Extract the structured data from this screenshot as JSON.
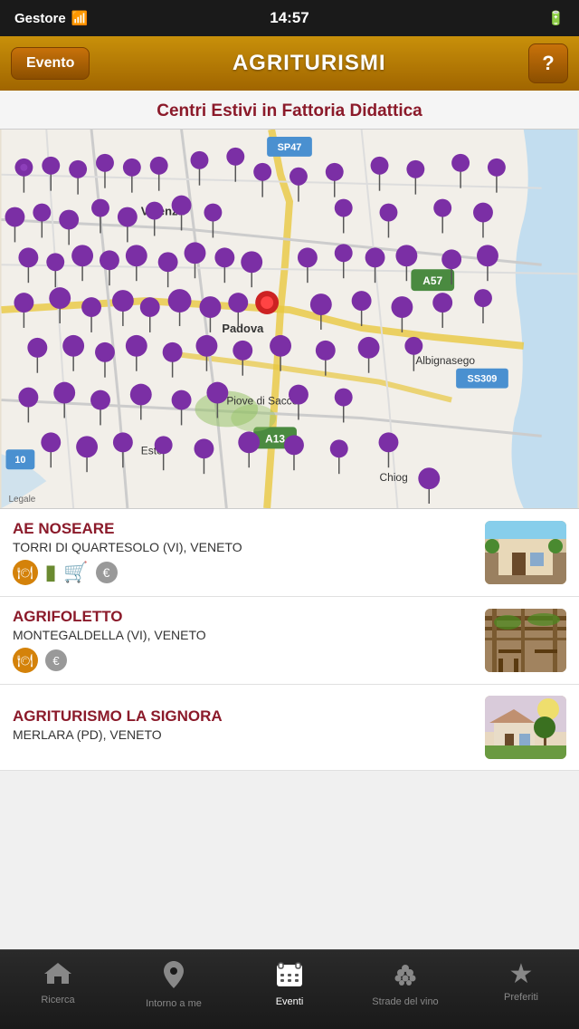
{
  "statusBar": {
    "carrier": "Gestore",
    "time": "14:57",
    "batteryIcon": "▐▌"
  },
  "navBar": {
    "eventoLabel": "Evento",
    "title": "AGRITURISMI",
    "helpLabel": "?"
  },
  "subtitle": "Centri Estivi in Fattoria Didattica",
  "map": {
    "altText": "Map of Veneto region showing agriturismo locations"
  },
  "listItems": [
    {
      "name": "AE NOSEARE",
      "location": "TORRI DI QUARTESOLO (VI), VENETO",
      "icons": [
        "fork",
        "coupon",
        "bag",
        "euro"
      ],
      "thumbColor": "#b8a080",
      "thumbAlt": "Farmhouse building"
    },
    {
      "name": "AGRIFOLETTO",
      "location": "MONTEGALDELLA (VI), VENETO",
      "icons": [
        "fork",
        "euro"
      ],
      "thumbColor": "#8a7060",
      "thumbAlt": "Covered terrace"
    },
    {
      "name": "AGRITURISMO LA SIGNORA",
      "location": "MERLARA (PD), VENETO",
      "icons": [],
      "thumbColor": "#c0b090",
      "thumbAlt": "Farm landscape"
    }
  ],
  "tabBar": {
    "tabs": [
      {
        "id": "ricerca",
        "label": "Ricerca",
        "icon": "🏠",
        "active": false
      },
      {
        "id": "intorno",
        "label": "Intorno a me",
        "icon": "📍",
        "active": false
      },
      {
        "id": "eventi",
        "label": "Eventi",
        "icon": "📅",
        "active": true
      },
      {
        "id": "strade",
        "label": "Strade del vino",
        "icon": "🍇",
        "active": false
      },
      {
        "id": "preferiti",
        "label": "Preferiti",
        "icon": "★",
        "active": false
      }
    ]
  }
}
